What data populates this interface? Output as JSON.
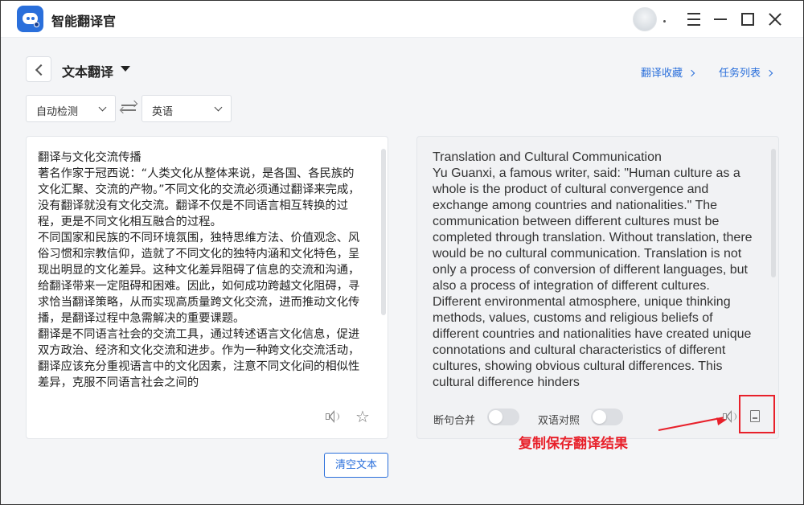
{
  "app": {
    "title": "智能翻译官",
    "logo_icon": "chat-bubble-icon",
    "accent_color": "#2a6fdb"
  },
  "window_controls": [
    "menu-icon",
    "minimize-icon",
    "maximize-icon",
    "close-icon"
  ],
  "header": {
    "mode_title": "文本翻译",
    "links": {
      "favorites": "翻译收藏",
      "tasks": "任务列表"
    }
  },
  "languages": {
    "source": "自动检测",
    "target": "英语"
  },
  "source_panel": {
    "text": "翻译与文化交流传播\n著名作家于冠西说：“人类文化从整体来说，是各国、各民族的文化汇聚、交流的产物。”不同文化的交流必须通过翻译来完成，没有翻译就没有文化交流。翻译不仅是不同语言相互转换的过程，更是不同文化相互融合的过程。\n不同国家和民族的不同环境氛围，独特思维方法、价值观念、风俗习惯和宗教信仰，造就了不同文化的独特内涵和文化特色，呈现出明显的文化差异。这种文化差异阻碍了信息的交流和沟通，给翻译带来一定阻碍和困难。因此，如何成功跨越文化阻碍，寻求恰当翻译策略，从而实现高质量跨文化交流，进而推动文化传播，是翻译过程中急需解决的重要课题。\n翻译是不同语言社会的交流工具，通过转述语言文化信息，促进双方政治、经济和文化交流和进步。作为一种跨文化交流活动，翻译应该充分重视语言中的文化因素，注意不同文化间的相似性差异，克服不同语言社会之间的"
  },
  "target_panel": {
    "text": "Translation and Cultural Communication\nYu Guanxi, a famous writer, said: \"Human culture as a whole is the product of cultural convergence and exchange among countries and nationalities.\" The communication between different cultures must be completed through translation. Without translation, there would be no cultural communication. Translation is not only a process of conversion of different languages, but also a process of integration of different cultures.\nDifferent environmental atmosphere, unique thinking methods, values, customs and religious beliefs of different countries and nationalities have created unique connotations and cultural characteristics of different cultures, showing obvious cultural differences. This cultural difference hinders",
    "toggle_sentence_merge": "断句合并",
    "toggle_bilingual": "双语对照"
  },
  "annotation": {
    "text": "复制保存翻译结果",
    "color": "#e8202a"
  },
  "clear_button": "清空文本"
}
